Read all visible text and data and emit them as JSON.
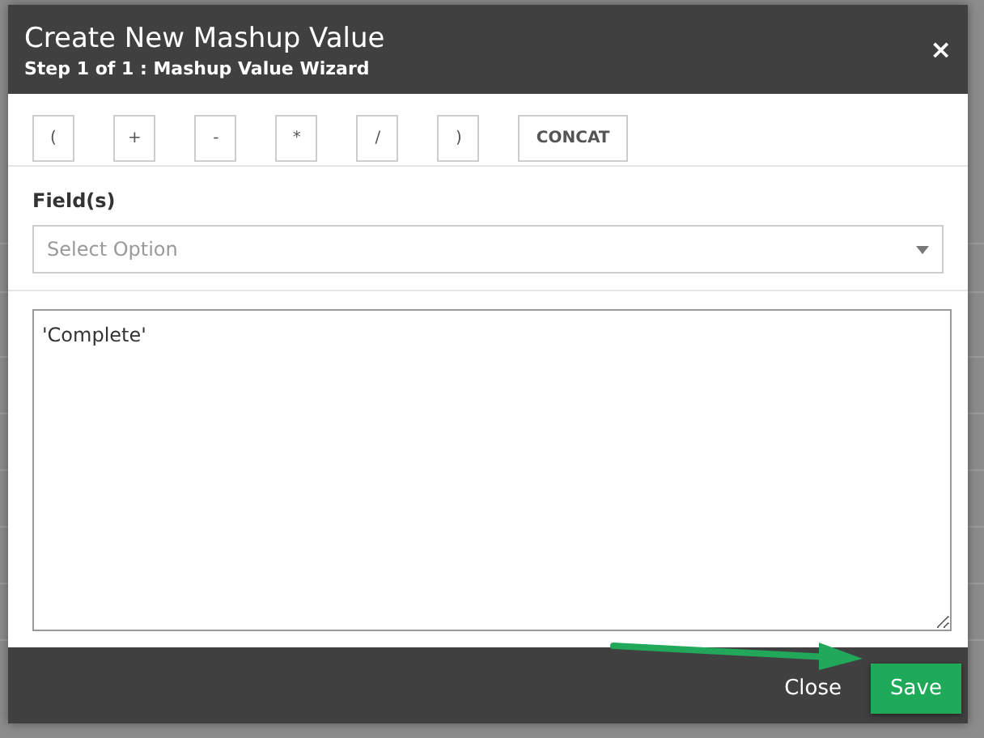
{
  "dialog": {
    "title": "Create New Mashup Value",
    "subtitle": "Step 1 of 1 : Mashup Value Wizard",
    "close_icon": "×"
  },
  "operators": [
    {
      "label": "("
    },
    {
      "label": "+"
    },
    {
      "label": "-"
    },
    {
      "label": "*"
    },
    {
      "label": "/"
    },
    {
      "label": ")"
    },
    {
      "label": "CONCAT"
    }
  ],
  "fields": {
    "label": "Field(s)",
    "placeholder": "Select Option"
  },
  "expression": {
    "value": "'Complete'"
  },
  "footer_buttons": [
    {
      "label": "Close",
      "kind": "link"
    },
    {
      "label": "Save",
      "kind": "primary"
    }
  ]
}
